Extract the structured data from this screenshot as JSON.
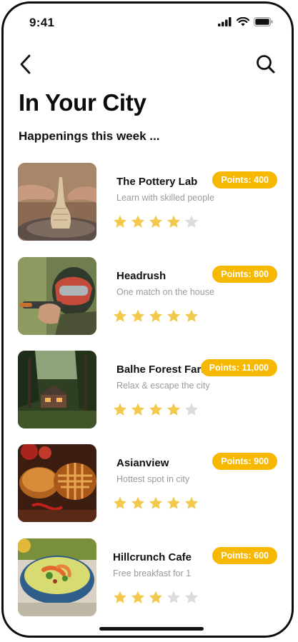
{
  "status_bar": {
    "time": "9:41",
    "icons": [
      "signal-icon",
      "wifi-icon",
      "battery-icon"
    ]
  },
  "nav": {
    "back_icon": "chevron-left-icon",
    "search_icon": "search-icon"
  },
  "page": {
    "title": "In Your City",
    "subtitle": "Happenings this week ..."
  },
  "colors": {
    "accent": "#f6b800",
    "star_filled": "#f2c94c",
    "star_empty": "#dcdcdc",
    "text": "#111111",
    "muted": "#9a9a9a"
  },
  "events": [
    {
      "title": "The Pottery Lab",
      "description": "Learn with skilled people",
      "points": "Points: 400",
      "rating": 4,
      "max_rating": 5,
      "image": "pottery-wheel-photo"
    },
    {
      "title": "Headrush",
      "description": "One match on the house",
      "points": "Points: 800",
      "rating": 5,
      "max_rating": 5,
      "image": "paintball-player-photo"
    },
    {
      "title": "Balhe Forest Farm",
      "description": "Relax & escape the city",
      "points": "Points: 11,000",
      "rating": 4,
      "max_rating": 5,
      "image": "forest-cabin-photo"
    },
    {
      "title": "Asianview",
      "description": "Hottest spot in city",
      "points": "Points: 900",
      "rating": 5,
      "max_rating": 5,
      "image": "pies-table-photo"
    },
    {
      "title": "Hillcrunch Cafe",
      "description": "Free breakfast for 1",
      "points": "Points: 600",
      "rating": 3,
      "max_rating": 5,
      "image": "soup-bowl-photo"
    }
  ]
}
